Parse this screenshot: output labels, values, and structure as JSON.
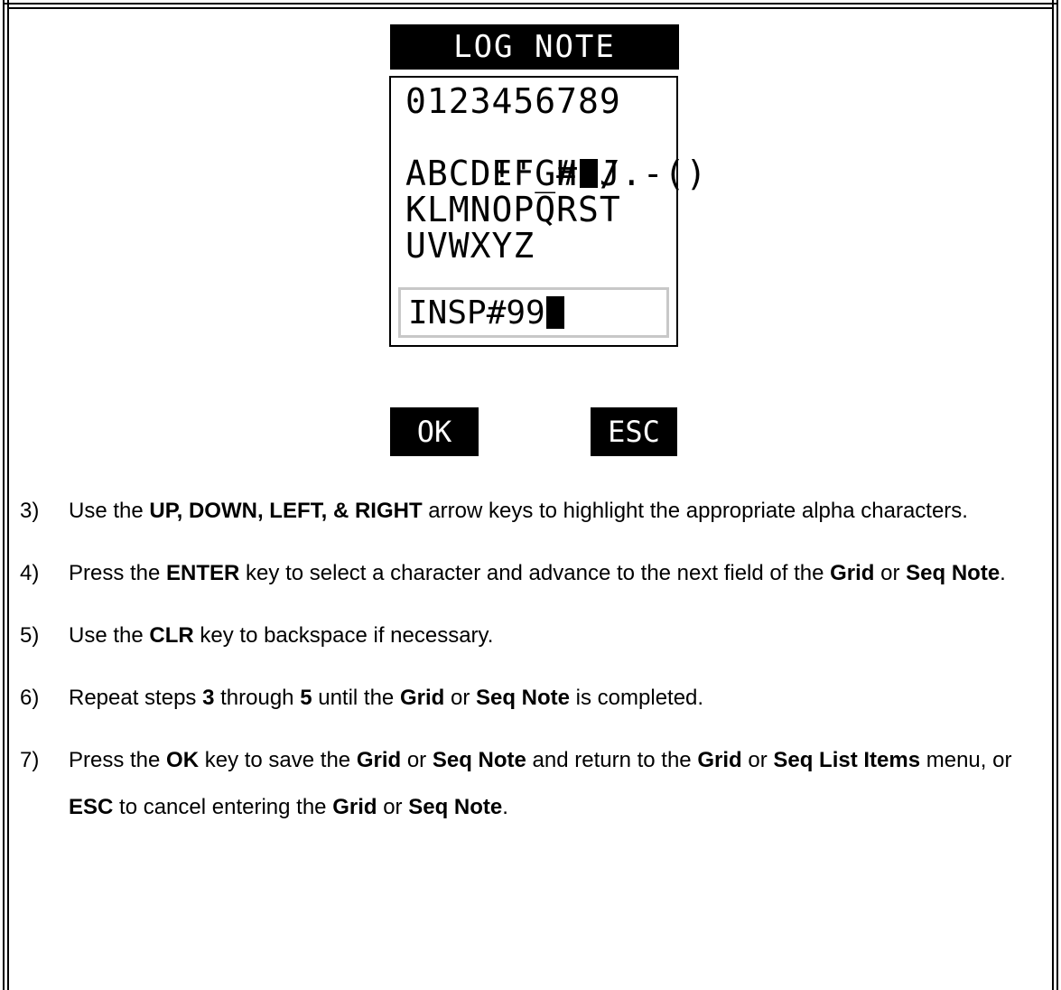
{
  "screen": {
    "title": "LOG NOTE",
    "char_rows": [
      "0123456789",
      "!'_#",
      "/.-()",
      "ABCDEFGHIJ",
      "KLMNOPQRST",
      "UVWXYZ"
    ],
    "entry_value": "INSP#99",
    "ok_label": "OK",
    "esc_label": "ESC"
  },
  "steps": [
    {
      "number": "3)",
      "parts": [
        {
          "t": "Use the ",
          "b": false
        },
        {
          "t": "UP, DOWN, LEFT, & RIGHT",
          "b": true
        },
        {
          "t": " arrow keys to highlight the appropriate alpha characters.",
          "b": false
        }
      ]
    },
    {
      "number": "4)",
      "parts": [
        {
          "t": "Press the ",
          "b": false
        },
        {
          "t": "ENTER",
          "b": true
        },
        {
          "t": " key to select a character and advance to the next field of the ",
          "b": false
        },
        {
          "t": "Grid",
          "b": true
        },
        {
          "t": " or ",
          "b": false
        },
        {
          "t": "Seq Note",
          "b": true
        },
        {
          "t": ".",
          "b": false
        }
      ]
    },
    {
      "number": "5)",
      "parts": [
        {
          "t": "Use the ",
          "b": false
        },
        {
          "t": "CLR",
          "b": true
        },
        {
          "t": " key to backspace if necessary.",
          "b": false
        }
      ]
    },
    {
      "number": "6)",
      "parts": [
        {
          "t": "Repeat steps ",
          "b": false
        },
        {
          "t": "3",
          "b": true
        },
        {
          "t": " through ",
          "b": false
        },
        {
          "t": "5",
          "b": true
        },
        {
          "t": " until the ",
          "b": false
        },
        {
          "t": "Grid",
          "b": true
        },
        {
          "t": " or ",
          "b": false
        },
        {
          "t": "Seq Note",
          "b": true
        },
        {
          "t": " is completed.",
          "b": false
        }
      ]
    },
    {
      "number": "7)",
      "parts": [
        {
          "t": "Press the ",
          "b": false
        },
        {
          "t": "OK",
          "b": true
        },
        {
          "t": " key to save the ",
          "b": false
        },
        {
          "t": "Grid",
          "b": true
        },
        {
          "t": " or ",
          "b": false
        },
        {
          "t": "Seq Note",
          "b": true
        },
        {
          "t": " and return to the ",
          "b": false
        },
        {
          "t": "Grid",
          "b": true
        },
        {
          "t": " or ",
          "b": false
        },
        {
          "t": "Seq List Items",
          "b": true
        },
        {
          "t": " menu, or ",
          "b": false
        },
        {
          "t": "ESC",
          "b": true
        },
        {
          "t": " to cancel entering the ",
          "b": false
        },
        {
          "t": "Grid",
          "b": true
        },
        {
          "t": " or ",
          "b": false
        },
        {
          "t": "Seq Note",
          "b": true
        },
        {
          "t": ".",
          "b": false
        }
      ]
    }
  ]
}
